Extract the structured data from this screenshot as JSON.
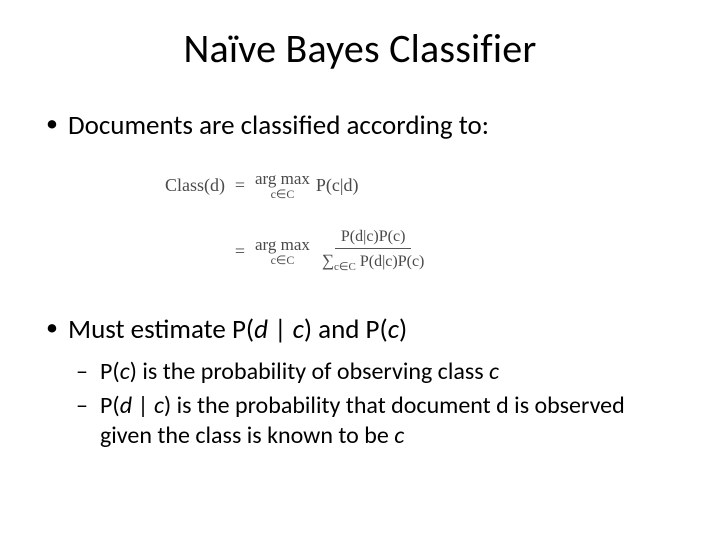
{
  "title": "Naïve Bayes Classifier",
  "bullets": {
    "b1": "Documents are classified according to:",
    "b2_prefix": "Must estimate P(",
    "b2_d": "d",
    "b2_mid": " | ",
    "b2_c1": "c",
    "b2_mid2": ") and P(",
    "b2_c2": "c",
    "b2_suffix": ")",
    "sub1_prefix": "P(",
    "sub1_c": "c",
    "sub1_mid": ") is the probability of observing class ",
    "sub1_c2": "c",
    "sub2_prefix": "P(",
    "sub2_d": "d",
    "sub2_bar": " | ",
    "sub2_c": "c",
    "sub2_mid": ") is the probability that document d is observed given the class is known to be ",
    "sub2_c2": "c"
  },
  "equations": {
    "lhs": "Class(d)",
    "eq": "=",
    "argmax_top": "arg max",
    "argmax_sub": "c∈C",
    "rhs1": "P(c|d)",
    "frac_num": "P(d|c)P(c)",
    "frac_den_sum": "∑",
    "frac_den_sub": "c∈C",
    "frac_den_rest": " P(d|c)P(c)"
  }
}
